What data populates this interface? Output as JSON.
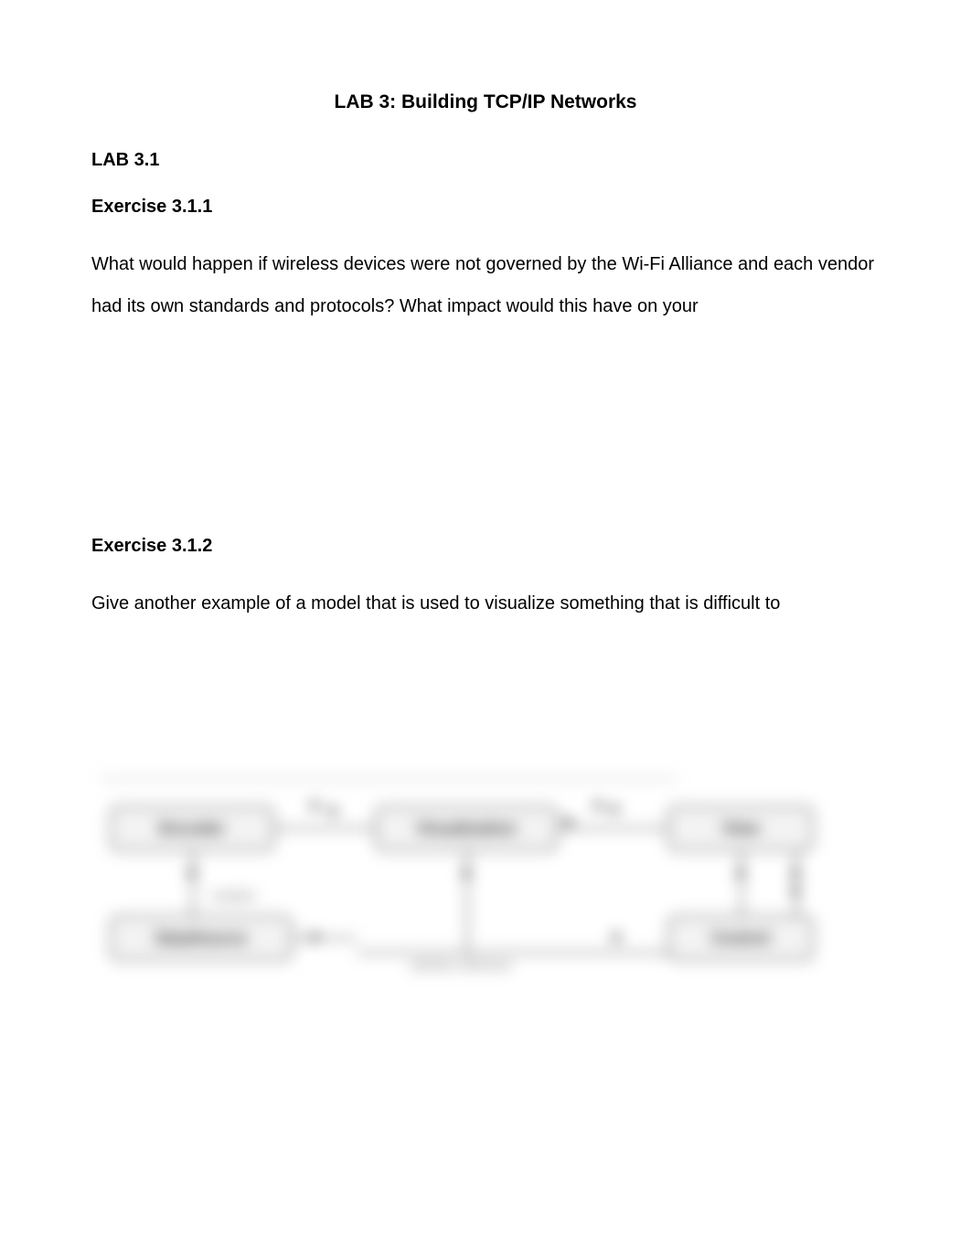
{
  "title": "LAB 3: Building TCP/IP Networks",
  "section1": {
    "heading": "LAB 3.1",
    "ex1": {
      "heading": "Exercise 3.1.1",
      "para": "What would happen if wireless devices were not governed by the Wi-Fi Alliance and each vendor had its own standards and protocols? What impact would this have on your"
    },
    "ex2": {
      "heading": "Exercise 3.1.2",
      "para": "Give another example of a model that is used to visualize something that is difficult to"
    }
  },
  "diagram": {
    "box1": "Encoder",
    "box2": "Visualization",
    "box3": "View",
    "box4": "DataSource",
    "box5": "Control",
    "label1": "creation",
    "label2": "prefuse reference"
  }
}
